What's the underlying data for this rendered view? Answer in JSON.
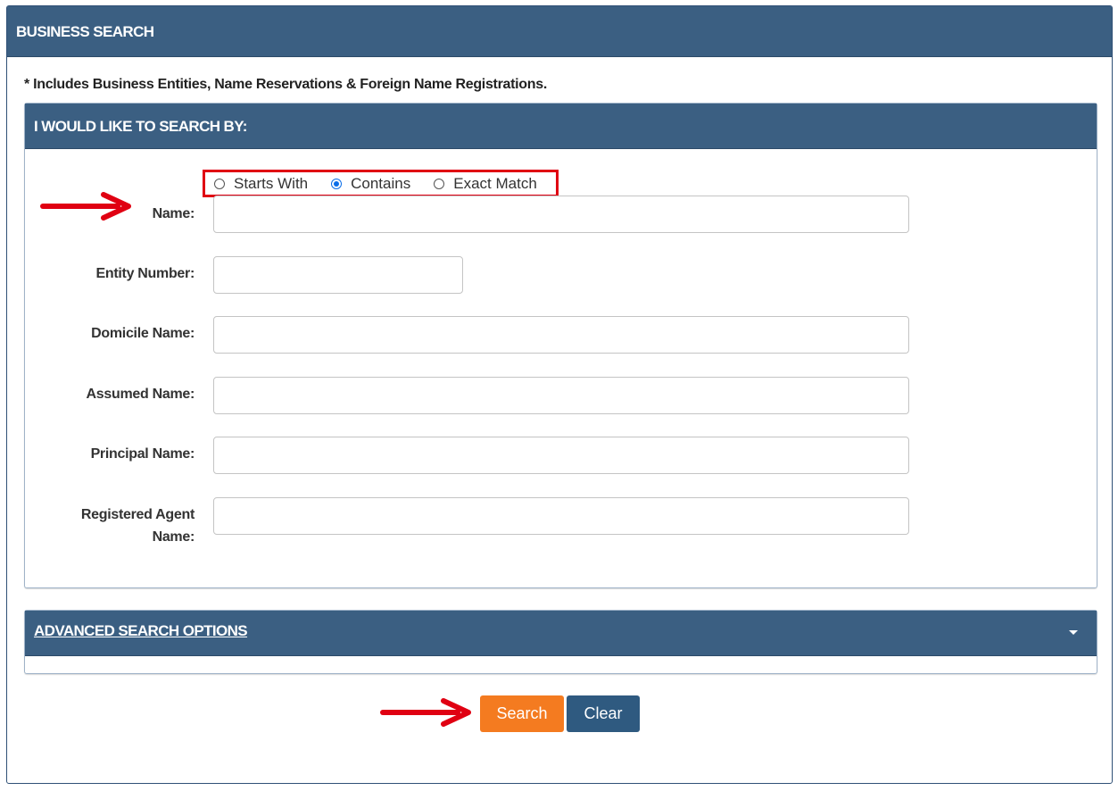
{
  "header": {
    "title": "BUSINESS SEARCH"
  },
  "note": "* Includes Business Entities, Name Reservations & Foreign Name Registrations.",
  "search_by": {
    "title": "I WOULD LIKE TO SEARCH BY:",
    "match_options": [
      {
        "label": "Starts With",
        "checked": false
      },
      {
        "label": "Contains",
        "checked": true
      },
      {
        "label": "Exact Match",
        "checked": false
      }
    ],
    "fields": {
      "name": {
        "label": "Name:",
        "value": ""
      },
      "entity_number": {
        "label": "Entity Number:",
        "value": ""
      },
      "domicile_name": {
        "label": "Domicile Name:",
        "value": ""
      },
      "assumed_name": {
        "label": "Assumed Name:",
        "value": ""
      },
      "principal_name": {
        "label": "Principal Name:",
        "value": ""
      },
      "registered_agent_name": {
        "label_line1": "Registered Agent",
        "label_line2": "Name:",
        "value": ""
      }
    }
  },
  "advanced": {
    "title": "ADVANCED SEARCH OPTIONS"
  },
  "buttons": {
    "search": "Search",
    "clear": "Clear"
  },
  "colors": {
    "header_bg": "#3b5f82",
    "search_button": "#f47b20",
    "clear_button": "#2f5a80",
    "highlight_red": "#e00012",
    "radio_checked": "#0b6ee8"
  }
}
